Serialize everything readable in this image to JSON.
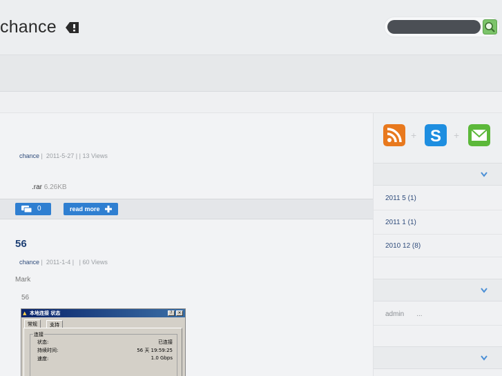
{
  "header": {
    "site_title": "chance",
    "search": {
      "placeholder": ""
    }
  },
  "posts": [
    {
      "meta": {
        "author": "chance",
        "separator": "|",
        "date": "2011-5-27",
        "views_text": "| | 13 Views"
      },
      "attachment": {
        "ext": ".rar",
        "size": "6.26KB"
      },
      "actions": {
        "comments": "0",
        "read_more": "read more"
      }
    },
    {
      "title": "56",
      "meta": {
        "author": "chance",
        "separator": "|",
        "date": "2011-1-4 |",
        "views_text": "| 60 Views"
      },
      "excerpt": "Mark",
      "subtext": "56",
      "screenshot": {
        "title": "本地连接 状态",
        "buttons": [
          "?",
          "×"
        ],
        "tabs": [
          "常规",
          "支持"
        ],
        "group_label": "连接",
        "rows": [
          {
            "label": "状态:",
            "value": "已连接"
          },
          {
            "label": "持续时间:",
            "value": "56 天 19:59:25"
          },
          {
            "label": "速度:",
            "value": "1.0 Gbps"
          }
        ]
      }
    }
  ],
  "sidebar": {
    "social": [
      {
        "name": "rss-icon",
        "color": "#e8791e"
      },
      {
        "name": "skype-icon",
        "color": "#1e8ee0"
      },
      {
        "name": "mail-icon",
        "color": "#5cb83a"
      }
    ],
    "plus_glyph": "+",
    "archives": [
      {
        "label": "2011 5 (1)"
      },
      {
        "label": "2011 1 (1)"
      },
      {
        "label": "2010 12 (8)"
      }
    ],
    "recent": {
      "author": "admin",
      "text": "..."
    }
  },
  "colors": {
    "accent": "#2f7fd1",
    "link": "#2d4a7a",
    "title": "#1d3f74"
  }
}
